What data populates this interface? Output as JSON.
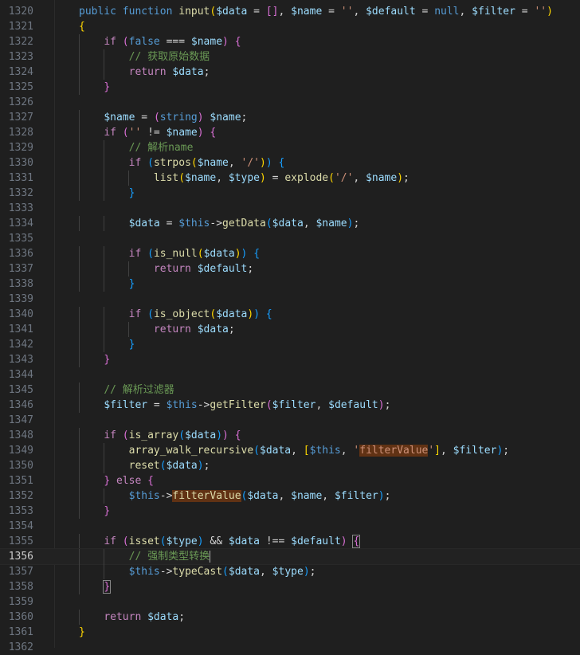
{
  "editor": {
    "current_line": 1356,
    "lines": [
      {
        "n": "1320",
        "t": [
          [
            "kw",
            "public "
          ],
          [
            "kw",
            "function "
          ],
          [
            "fn",
            "input"
          ],
          [
            "b1",
            "("
          ],
          [
            "var",
            "$data"
          ],
          [
            "pn",
            " = "
          ],
          [
            "b2",
            "[]"
          ],
          [
            "pn",
            ", "
          ],
          [
            "var",
            "$name"
          ],
          [
            "pn",
            " = "
          ],
          [
            "str",
            "''"
          ],
          [
            "pn",
            ", "
          ],
          [
            "var",
            "$default"
          ],
          [
            "pn",
            " = "
          ],
          [
            "kw",
            "null"
          ],
          [
            "pn",
            ", "
          ],
          [
            "var",
            "$filter"
          ],
          [
            "pn",
            " = "
          ],
          [
            "str",
            "''"
          ],
          [
            "b1",
            ")"
          ]
        ]
      },
      {
        "n": "1321",
        "t": [
          [
            "b1",
            "{"
          ]
        ]
      },
      {
        "n": "1322",
        "t": [
          [
            "pn",
            "    "
          ],
          [
            "ctl",
            "if "
          ],
          [
            "b2",
            "("
          ],
          [
            "kw",
            "false"
          ],
          [
            "pn",
            " === "
          ],
          [
            "var",
            "$name"
          ],
          [
            "b2",
            ")"
          ],
          [
            "pn",
            " "
          ],
          [
            "b2",
            "{"
          ]
        ]
      },
      {
        "n": "1323",
        "t": [
          [
            "pn",
            "        "
          ],
          [
            "cm",
            "// 获取原始数据"
          ]
        ]
      },
      {
        "n": "1324",
        "t": [
          [
            "pn",
            "        "
          ],
          [
            "ctl",
            "return "
          ],
          [
            "var",
            "$data"
          ],
          [
            "pn",
            ";"
          ]
        ]
      },
      {
        "n": "1325",
        "t": [
          [
            "pn",
            "    "
          ],
          [
            "b2",
            "}"
          ]
        ]
      },
      {
        "n": "1326",
        "t": []
      },
      {
        "n": "1327",
        "t": [
          [
            "pn",
            "    "
          ],
          [
            "var",
            "$name"
          ],
          [
            "pn",
            " = "
          ],
          [
            "b2",
            "("
          ],
          [
            "kw",
            "string"
          ],
          [
            "b2",
            ")"
          ],
          [
            "pn",
            " "
          ],
          [
            "var",
            "$name"
          ],
          [
            "pn",
            ";"
          ]
        ]
      },
      {
        "n": "1328",
        "t": [
          [
            "pn",
            "    "
          ],
          [
            "ctl",
            "if "
          ],
          [
            "b2",
            "("
          ],
          [
            "str",
            "''"
          ],
          [
            "pn",
            " != "
          ],
          [
            "var",
            "$name"
          ],
          [
            "b2",
            ")"
          ],
          [
            "pn",
            " "
          ],
          [
            "b2",
            "{"
          ]
        ]
      },
      {
        "n": "1329",
        "t": [
          [
            "pn",
            "        "
          ],
          [
            "cm",
            "// 解析name"
          ]
        ]
      },
      {
        "n": "1330",
        "t": [
          [
            "pn",
            "        "
          ],
          [
            "ctl",
            "if "
          ],
          [
            "b3",
            "("
          ],
          [
            "fn",
            "strpos"
          ],
          [
            "b1",
            "("
          ],
          [
            "var",
            "$name"
          ],
          [
            "pn",
            ", "
          ],
          [
            "str",
            "'/'"
          ],
          [
            "b1",
            ")"
          ],
          [
            "b3",
            ")"
          ],
          [
            "pn",
            " "
          ],
          [
            "b3",
            "{"
          ]
        ]
      },
      {
        "n": "1331",
        "t": [
          [
            "pn",
            "            "
          ],
          [
            "fn",
            "list"
          ],
          [
            "b1",
            "("
          ],
          [
            "var",
            "$name"
          ],
          [
            "pn",
            ", "
          ],
          [
            "var",
            "$type"
          ],
          [
            "b1",
            ")"
          ],
          [
            "pn",
            " = "
          ],
          [
            "fn",
            "explode"
          ],
          [
            "b1",
            "("
          ],
          [
            "str",
            "'/'"
          ],
          [
            "pn",
            ", "
          ],
          [
            "var",
            "$name"
          ],
          [
            "b1",
            ")"
          ],
          [
            "pn",
            ";"
          ]
        ]
      },
      {
        "n": "1332",
        "t": [
          [
            "pn",
            "        "
          ],
          [
            "b3",
            "}"
          ]
        ]
      },
      {
        "n": "1333",
        "t": []
      },
      {
        "n": "1334",
        "t": [
          [
            "pn",
            "        "
          ],
          [
            "var",
            "$data"
          ],
          [
            "pn",
            " = "
          ],
          [
            "kw",
            "$this"
          ],
          [
            "pn",
            "->"
          ],
          [
            "fn",
            "getData"
          ],
          [
            "b3",
            "("
          ],
          [
            "var",
            "$data"
          ],
          [
            "pn",
            ", "
          ],
          [
            "var",
            "$name"
          ],
          [
            "b3",
            ")"
          ],
          [
            "pn",
            ";"
          ]
        ]
      },
      {
        "n": "1335",
        "t": []
      },
      {
        "n": "1336",
        "t": [
          [
            "pn",
            "        "
          ],
          [
            "ctl",
            "if "
          ],
          [
            "b3",
            "("
          ],
          [
            "fn",
            "is_null"
          ],
          [
            "b1",
            "("
          ],
          [
            "var",
            "$data"
          ],
          [
            "b1",
            ")"
          ],
          [
            "b3",
            ")"
          ],
          [
            "pn",
            " "
          ],
          [
            "b3",
            "{"
          ]
        ]
      },
      {
        "n": "1337",
        "t": [
          [
            "pn",
            "            "
          ],
          [
            "ctl",
            "return "
          ],
          [
            "var",
            "$default"
          ],
          [
            "pn",
            ";"
          ]
        ]
      },
      {
        "n": "1338",
        "t": [
          [
            "pn",
            "        "
          ],
          [
            "b3",
            "}"
          ]
        ]
      },
      {
        "n": "1339",
        "t": []
      },
      {
        "n": "1340",
        "t": [
          [
            "pn",
            "        "
          ],
          [
            "ctl",
            "if "
          ],
          [
            "b3",
            "("
          ],
          [
            "fn",
            "is_object"
          ],
          [
            "b1",
            "("
          ],
          [
            "var",
            "$data"
          ],
          [
            "b1",
            ")"
          ],
          [
            "b3",
            ")"
          ],
          [
            "pn",
            " "
          ],
          [
            "b3",
            "{"
          ]
        ]
      },
      {
        "n": "1341",
        "t": [
          [
            "pn",
            "            "
          ],
          [
            "ctl",
            "return "
          ],
          [
            "var",
            "$data"
          ],
          [
            "pn",
            ";"
          ]
        ]
      },
      {
        "n": "1342",
        "t": [
          [
            "pn",
            "        "
          ],
          [
            "b3",
            "}"
          ]
        ]
      },
      {
        "n": "1343",
        "t": [
          [
            "pn",
            "    "
          ],
          [
            "b2",
            "}"
          ]
        ]
      },
      {
        "n": "1344",
        "t": []
      },
      {
        "n": "1345",
        "t": [
          [
            "pn",
            "    "
          ],
          [
            "cm",
            "// 解析过滤器"
          ]
        ]
      },
      {
        "n": "1346",
        "t": [
          [
            "pn",
            "    "
          ],
          [
            "var",
            "$filter"
          ],
          [
            "pn",
            " = "
          ],
          [
            "kw",
            "$this"
          ],
          [
            "pn",
            "->"
          ],
          [
            "fn",
            "getFilter"
          ],
          [
            "b2",
            "("
          ],
          [
            "var",
            "$filter"
          ],
          [
            "pn",
            ", "
          ],
          [
            "var",
            "$default"
          ],
          [
            "b2",
            ")"
          ],
          [
            "pn",
            ";"
          ]
        ]
      },
      {
        "n": "1347",
        "t": []
      },
      {
        "n": "1348",
        "t": [
          [
            "pn",
            "    "
          ],
          [
            "ctl",
            "if "
          ],
          [
            "b2",
            "("
          ],
          [
            "fn",
            "is_array"
          ],
          [
            "b3",
            "("
          ],
          [
            "var",
            "$data"
          ],
          [
            "b3",
            ")"
          ],
          [
            "b2",
            ")"
          ],
          [
            "pn",
            " "
          ],
          [
            "b2",
            "{"
          ]
        ]
      },
      {
        "n": "1349",
        "t": [
          [
            "pn",
            "        "
          ],
          [
            "fn",
            "array_walk_recursive"
          ],
          [
            "b3",
            "("
          ],
          [
            "var",
            "$data"
          ],
          [
            "pn",
            ", "
          ],
          [
            "b1",
            "["
          ],
          [
            "kw",
            "$this"
          ],
          [
            "pn",
            ", "
          ],
          [
            "str",
            "'"
          ],
          [
            "str hl",
            "filterValue"
          ],
          [
            "str",
            "'"
          ],
          [
            "b1",
            "]"
          ],
          [
            "pn",
            ", "
          ],
          [
            "var",
            "$filter"
          ],
          [
            "b3",
            ")"
          ],
          [
            "pn",
            ";"
          ]
        ]
      },
      {
        "n": "1350",
        "t": [
          [
            "pn",
            "        "
          ],
          [
            "fn",
            "reset"
          ],
          [
            "b3",
            "("
          ],
          [
            "var",
            "$data"
          ],
          [
            "b3",
            ")"
          ],
          [
            "pn",
            ";"
          ]
        ]
      },
      {
        "n": "1351",
        "t": [
          [
            "pn",
            "    "
          ],
          [
            "b2",
            "}"
          ],
          [
            "pn",
            " "
          ],
          [
            "ctl",
            "else"
          ],
          [
            "pn",
            " "
          ],
          [
            "b2",
            "{"
          ]
        ]
      },
      {
        "n": "1352",
        "t": [
          [
            "pn",
            "        "
          ],
          [
            "kw",
            "$this"
          ],
          [
            "pn",
            "->"
          ],
          [
            "fn hl",
            "filterValue"
          ],
          [
            "b3",
            "("
          ],
          [
            "var",
            "$data"
          ],
          [
            "pn",
            ", "
          ],
          [
            "var",
            "$name"
          ],
          [
            "pn",
            ", "
          ],
          [
            "var",
            "$filter"
          ],
          [
            "b3",
            ")"
          ],
          [
            "pn",
            ";"
          ]
        ]
      },
      {
        "n": "1353",
        "t": [
          [
            "pn",
            "    "
          ],
          [
            "b2",
            "}"
          ]
        ]
      },
      {
        "n": "1354",
        "t": []
      },
      {
        "n": "1355",
        "t": [
          [
            "pn",
            "    "
          ],
          [
            "ctl",
            "if "
          ],
          [
            "b2",
            "("
          ],
          [
            "fn",
            "isset"
          ],
          [
            "b3",
            "("
          ],
          [
            "var",
            "$type"
          ],
          [
            "b3",
            ")"
          ],
          [
            "pn",
            " && "
          ],
          [
            "var",
            "$data"
          ],
          [
            "pn",
            " !== "
          ],
          [
            "var",
            "$default"
          ],
          [
            "b2",
            ")"
          ],
          [
            "pn",
            " "
          ],
          [
            "b2 bmatch",
            "{"
          ]
        ]
      },
      {
        "n": "1356",
        "t": [
          [
            "pn",
            "        "
          ],
          [
            "cm",
            "// 强制类型转换"
          ],
          [
            "cursor",
            ""
          ]
        ]
      },
      {
        "n": "1357",
        "t": [
          [
            "pn",
            "        "
          ],
          [
            "kw",
            "$this"
          ],
          [
            "pn",
            "->"
          ],
          [
            "fn",
            "typeCast"
          ],
          [
            "b3",
            "("
          ],
          [
            "var",
            "$data"
          ],
          [
            "pn",
            ", "
          ],
          [
            "var",
            "$type"
          ],
          [
            "b3",
            ")"
          ],
          [
            "pn",
            ";"
          ]
        ]
      },
      {
        "n": "1358",
        "t": [
          [
            "pn",
            "    "
          ],
          [
            "b2 bmatch",
            "}"
          ]
        ]
      },
      {
        "n": "1359",
        "t": []
      },
      {
        "n": "1360",
        "t": [
          [
            "pn",
            "    "
          ],
          [
            "ctl",
            "return "
          ],
          [
            "var",
            "$data"
          ],
          [
            "pn",
            ";"
          ]
        ]
      },
      {
        "n": "1361",
        "t": [
          [
            "b1",
            "}"
          ]
        ]
      },
      {
        "n": "1362",
        "t": []
      }
    ]
  }
}
